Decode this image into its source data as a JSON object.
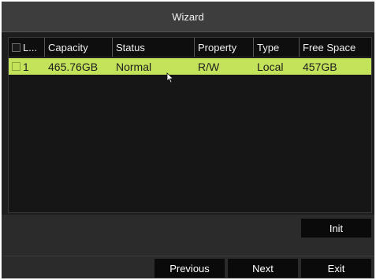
{
  "window": {
    "title": "Wizard"
  },
  "table": {
    "columns": [
      "L...",
      "Capacity",
      "Status",
      "Property",
      "Type",
      "Free Space"
    ],
    "rows": [
      {
        "label": "1",
        "capacity": "465.76GB",
        "status": "Normal",
        "property": "R/W",
        "type": "Local",
        "free_space": "457GB",
        "selected": true
      }
    ]
  },
  "buttons": {
    "init": "Init",
    "previous": "Previous",
    "next": "Next",
    "exit": "Exit"
  },
  "colors": {
    "selected_row": "#c2e35a",
    "title_bar": "#3d3d3d",
    "button_bg": "#0a0a0a"
  }
}
